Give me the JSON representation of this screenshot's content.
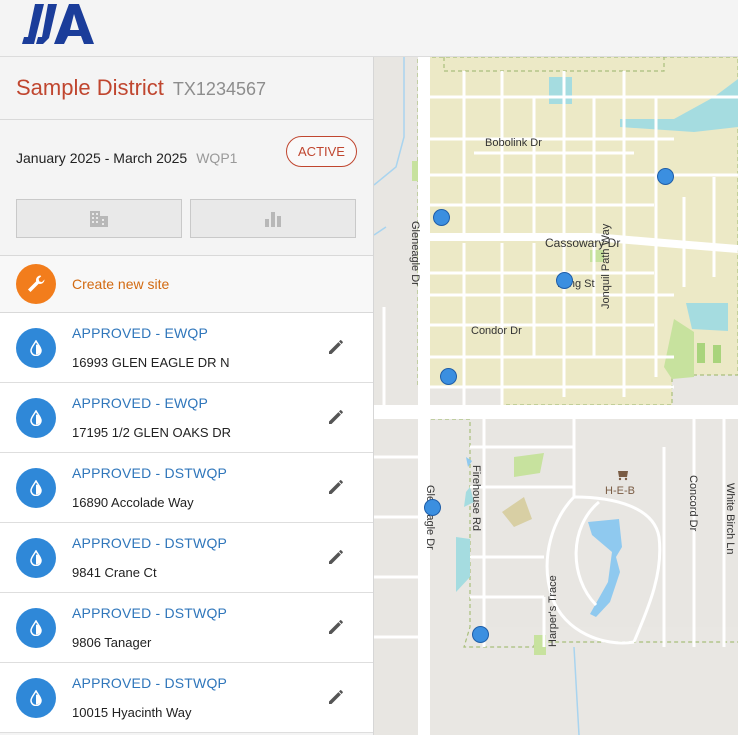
{
  "brand": {
    "logo_text": "LJA",
    "logo_color": "#1b3d9a"
  },
  "district": {
    "name": "Sample District",
    "id": "TX1234567"
  },
  "period": {
    "range": "January 2025 - March 2025",
    "code": "WQP1",
    "status_label": "ACTIVE"
  },
  "toggles": [
    {
      "icon": "building-icon"
    },
    {
      "icon": "bar-chart-icon"
    }
  ],
  "create": {
    "label": "Create new site",
    "icon": "wrench-icon",
    "color": "#f27d1c"
  },
  "sites": [
    {
      "status": "APPROVED - EWQP",
      "address": "16993 GLEN EAGLE DR N"
    },
    {
      "status": "APPROVED - EWQP",
      "address": "17195 1/2 GLEN OAKS DR"
    },
    {
      "status": "APPROVED - DSTWQP",
      "address": "16890 Accolade Way"
    },
    {
      "status": "APPROVED - DSTWQP",
      "address": "9841 Crane Ct"
    },
    {
      "status": "APPROVED - DSTWQP",
      "address": "9806 Tanager"
    },
    {
      "status": "APPROVED - DSTWQP",
      "address": "10015 Hyacinth Way"
    }
  ],
  "map": {
    "streets": {
      "bobolink": "Bobolink Dr",
      "cassowary": "Cassowary Dr",
      "wing": "Wing St",
      "jonquil": "Jonquil Path Way",
      "condor": "Condor Dr",
      "gleneagle_north": "Gleneagle Dr",
      "gleneagle_south": "Gleneagle Dr",
      "firehouse": "Firehouse Rd",
      "harpers": "Harper's Trace",
      "concord": "Concord Dr",
      "whitebirch": "White Birch Ln"
    },
    "poi": {
      "store": "H-E-B"
    }
  }
}
